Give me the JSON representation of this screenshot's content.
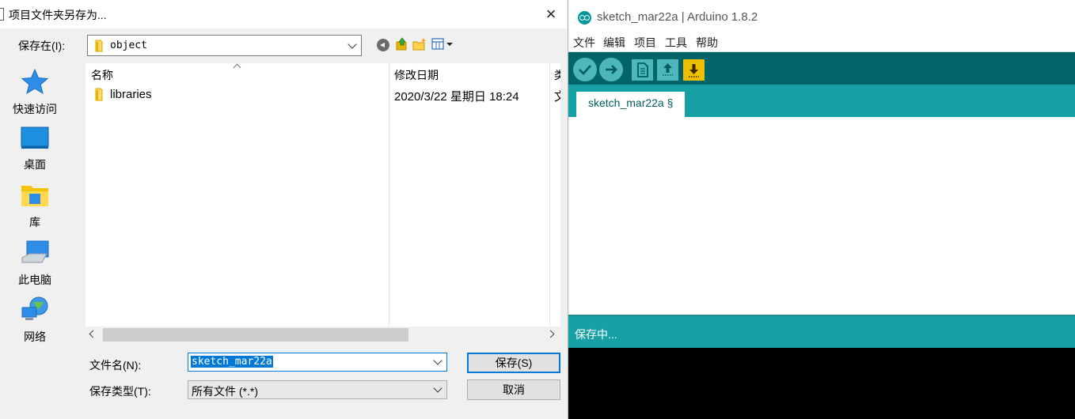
{
  "dialog": {
    "title": "项目文件夹另存为...",
    "close_icon": "×",
    "save_in_label": "保存在(I):",
    "save_in_value": "object",
    "places": [
      {
        "label": "快速访问",
        "icon": "quick-access-star-icon"
      },
      {
        "label": "桌面",
        "icon": "desktop-icon"
      },
      {
        "label": "库",
        "icon": "library-icon"
      },
      {
        "label": "此电脑",
        "icon": "this-pc-icon"
      },
      {
        "label": "网络",
        "icon": "network-icon"
      }
    ],
    "columns": [
      "名称",
      "修改日期",
      "类"
    ],
    "files": [
      {
        "name": "libraries",
        "modified": "2020/3/22 星期日 18:24",
        "type": "文"
      }
    ],
    "file_name_label": "文件名(N):",
    "file_name_value": "sketch_mar22a",
    "file_type_label": "保存类型(T):",
    "file_type_value": "所有文件 (*.*)",
    "save_button": "保存(S)",
    "cancel_button": "取消"
  },
  "ide": {
    "title": "sketch_mar22a | Arduino 1.8.2",
    "menu": [
      "文件",
      "编辑",
      "项目",
      "工具",
      "帮助"
    ],
    "toolbar": [
      "verify-icon",
      "upload-icon",
      "new-icon",
      "open-icon",
      "save-icon"
    ],
    "tab_label": "sketch_mar22a §",
    "status_text": "保存中...",
    "colors": {
      "toolbar": "#006468",
      "tabbar": "#17a1a5",
      "button": "#4db7bb",
      "export": "#f0c000"
    }
  }
}
